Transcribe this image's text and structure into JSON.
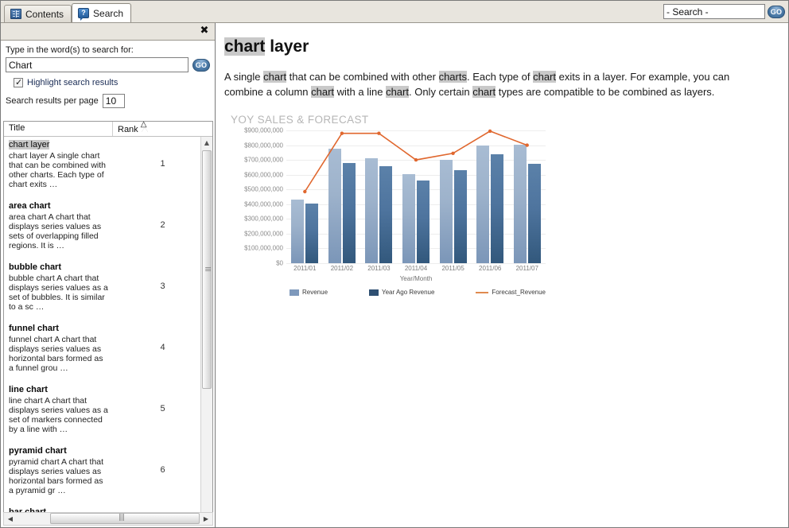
{
  "window": {
    "tabs": [
      {
        "label": "Contents",
        "icon": "book-icon",
        "active": false
      },
      {
        "label": "Search",
        "icon": "question-bubble-icon",
        "active": true
      }
    ]
  },
  "top_search": {
    "value": "- Search -",
    "placeholder": "- Search -",
    "go_label": "GO"
  },
  "search_panel": {
    "close_label": "✖",
    "prompt": "Type in the word(s) to search for:",
    "query_value": "Chart",
    "query_placeholder": "",
    "go_label": "GO",
    "highlight_label": "Highlight search results",
    "highlight_checked": true,
    "per_page_label": "Search results per page",
    "per_page_value": "10"
  },
  "results": {
    "columns": [
      "Title",
      "Rank"
    ],
    "sort_column": "Rank",
    "sort_direction": "ascending",
    "rows": [
      {
        "title": "chart layer",
        "title_highlighted": true,
        "snippet": "chart layer A single chart that can be combined with other charts. Each type of chart exits …",
        "rank": "1"
      },
      {
        "title": "area chart",
        "title_highlighted": false,
        "snippet": "area chart A chart that displays series values as sets of overlapping filled regions. It is …",
        "rank": "2"
      },
      {
        "title": "bubble chart",
        "title_highlighted": false,
        "snippet": "bubble chart A chart that displays series values as a set of bubbles. It is similar to a sc …",
        "rank": "3"
      },
      {
        "title": "funnel chart",
        "title_highlighted": false,
        "snippet": "funnel chart A chart that displays series values as horizontal bars formed as a funnel grou …",
        "rank": "4"
      },
      {
        "title": "line chart",
        "title_highlighted": false,
        "snippet": "line chart A chart that displays series values as a set of markers connected by a line with …",
        "rank": "5"
      },
      {
        "title": "pyramid chart",
        "title_highlighted": false,
        "snippet": "pyramid chart A chart that displays series values as horizontal bars formed as a pyramid gr …",
        "rank": "6"
      },
      {
        "title": "bar chart",
        "title_highlighted": false,
        "snippet": "",
        "rank": ""
      }
    ]
  },
  "document": {
    "title_highlight": "chart",
    "title_rest": " layer",
    "paragraph_parts": [
      {
        "t": "A single ",
        "h": false
      },
      {
        "t": "chart",
        "h": true
      },
      {
        "t": " that can be combined with other ",
        "h": false
      },
      {
        "t": "charts",
        "h": true
      },
      {
        "t": ". Each type of ",
        "h": false
      },
      {
        "t": "chart",
        "h": true
      },
      {
        "t": " exits in a layer. For example, you can combine a column ",
        "h": false
      },
      {
        "t": "chart",
        "h": true
      },
      {
        "t": " with a line ",
        "h": false
      },
      {
        "t": "chart",
        "h": true
      },
      {
        "t": ". Only certain ",
        "h": false
      },
      {
        "t": "chart",
        "h": true
      },
      {
        "t": " types are compatible to be combined as layers.",
        "h": false
      }
    ]
  },
  "chart_data": {
    "type": "bar",
    "title": "YOY SALES & FORECAST",
    "xlabel": "Year/Month",
    "ylabel": "",
    "ylim": [
      0,
      900000000
    ],
    "ytick_values": [
      0,
      100000000,
      200000000,
      300000000,
      400000000,
      500000000,
      600000000,
      700000000,
      800000000,
      900000000
    ],
    "ytick_labels": [
      "$0",
      "$100,000,000",
      "$200,000,000",
      "$300,000,000",
      "$400,000,000",
      "$500,000,000",
      "$600,000,000",
      "$700,000,000",
      "$800,000,000",
      "$900,000,000"
    ],
    "categories": [
      "2011/01",
      "2011/02",
      "2011/03",
      "2011/04",
      "2011/05",
      "2011/06",
      "2011/07"
    ],
    "grid": true,
    "legend_position": "bottom",
    "series": [
      {
        "name": "Revenue",
        "type": "bar",
        "color": "#8da5c4",
        "values": [
          430000000,
          775000000,
          710000000,
          605000000,
          700000000,
          795000000,
          805000000
        ]
      },
      {
        "name": "Year Ago Revenue",
        "type": "bar",
        "color": "#2e4f72",
        "values": [
          405000000,
          680000000,
          660000000,
          560000000,
          630000000,
          740000000,
          675000000
        ]
      },
      {
        "name": "Forecast_Revenue",
        "type": "line",
        "color": "#e0672e",
        "values": [
          485000000,
          880000000,
          880000000,
          700000000,
          745000000,
          895000000,
          800000000
        ]
      }
    ]
  }
}
